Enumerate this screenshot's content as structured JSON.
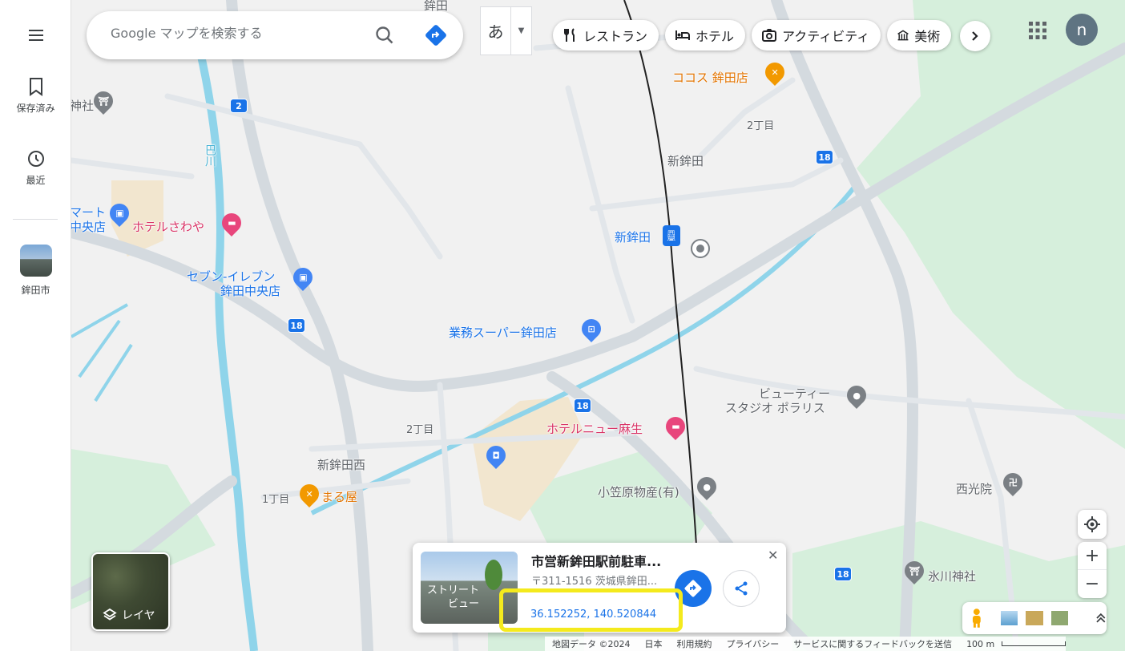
{
  "rail": {
    "menu_icon": "hamburger-menu-icon",
    "saved_label": "保存済み",
    "recent_label": "最近",
    "recent_place_label": "鉾田市"
  },
  "search": {
    "placeholder": "Google マップを検索する"
  },
  "ime": {
    "label": "あ"
  },
  "chips": [
    {
      "label": "レストラン",
      "icon": "fork-knife-icon"
    },
    {
      "label": "ホテル",
      "icon": "bed-icon"
    },
    {
      "label": "アクティビティ",
      "icon": "camera-icon"
    },
    {
      "label": "美術",
      "icon": "museum-icon"
    }
  ],
  "account": {
    "initial": "n"
  },
  "map_labels": {
    "hokota_top": "鉾田",
    "cocos": "ココス 鉾田店",
    "nichome_ne": "2丁目",
    "shinhokota": "新鉾田",
    "shinhokota_station": "新鉾田",
    "route_18_a": "18",
    "route_18_b": "18",
    "route_18_c": "18",
    "route_18_d": "18",
    "route_2": "2",
    "mart_a": "マート",
    "mart_b": "中央店",
    "hotel_sawaya": "ホテルさわや",
    "seven_a": "セブン-イレブン",
    "seven_b": "鉾田中央店",
    "gyomu": "業務スーパー鉾田店",
    "beauty_a": "ビューティー",
    "beauty_b": "スタジオ ポラリス",
    "hotel_new_aso": "ホテルニュー麻生",
    "nichome_sw": "2丁目",
    "shinhokota_nishi": "新鉾田西",
    "itchome": "1丁目",
    "maruya": "まる屋",
    "ogasawara": "小笠原物産(有)",
    "saikoin": "西光院",
    "hikawa": "氷川神社",
    "jinja_left": "神社",
    "river_label": "巴川"
  },
  "layer": {
    "label": "レイヤ"
  },
  "card": {
    "title": "市営新鉾田駅前駐車...",
    "address": "〒311-1516 茨城県鉾田...",
    "coords": "36.152252, 140.520844",
    "streetview_label_1": "ストリート",
    "streetview_label_2": "ビュー"
  },
  "footer": {
    "map_data": "地図データ ©2024",
    "country": "日本",
    "terms": "利用規約",
    "privacy": "プライバシー",
    "feedback": "サービスに関するフィードバックを送信",
    "scale": "100 m"
  },
  "colors": {
    "accent": "#1a73e8",
    "highlight": "#f4ea1d",
    "road": "#d4dadf",
    "water": "#8fd4ea",
    "park": "#c8ecd4"
  }
}
